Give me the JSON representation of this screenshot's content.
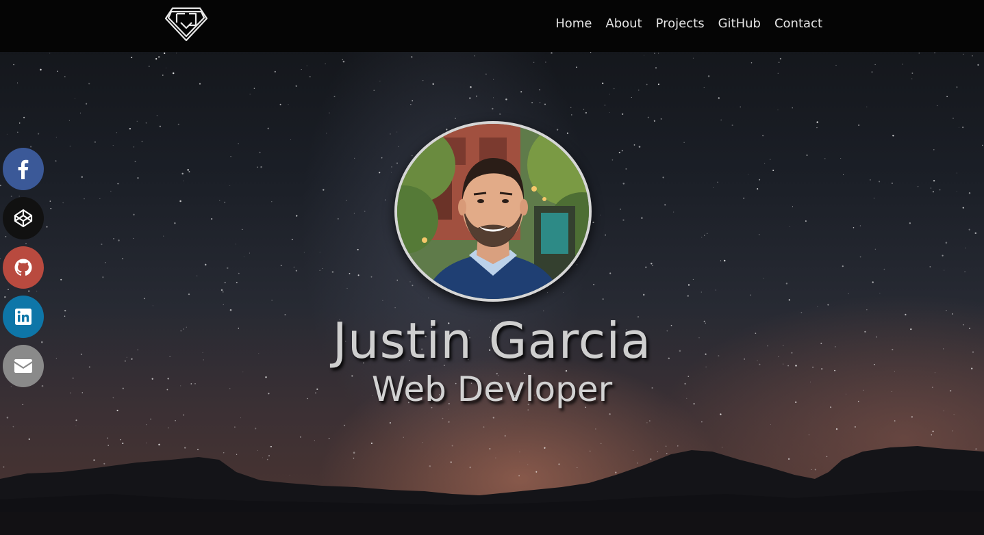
{
  "navbar": {
    "logo_icon": "diamond-monogram-logo",
    "links": [
      {
        "label": "Home"
      },
      {
        "label": "About"
      },
      {
        "label": "Projects"
      },
      {
        "label": "GitHub"
      },
      {
        "label": "Contact"
      }
    ]
  },
  "social": [
    {
      "name": "facebook",
      "icon": "facebook-icon",
      "color": "#3b5998"
    },
    {
      "name": "codepen",
      "icon": "codepen-icon",
      "color": "#111111"
    },
    {
      "name": "github",
      "icon": "github-icon",
      "color": "#b94a3f"
    },
    {
      "name": "linkedin",
      "icon": "linkedin-icon",
      "color": "#0e76a8"
    },
    {
      "name": "email",
      "icon": "envelope-icon",
      "color": "#8a8a8a"
    }
  ],
  "hero": {
    "name": "Justin Garcia",
    "subtitle": "Web Devloper"
  }
}
